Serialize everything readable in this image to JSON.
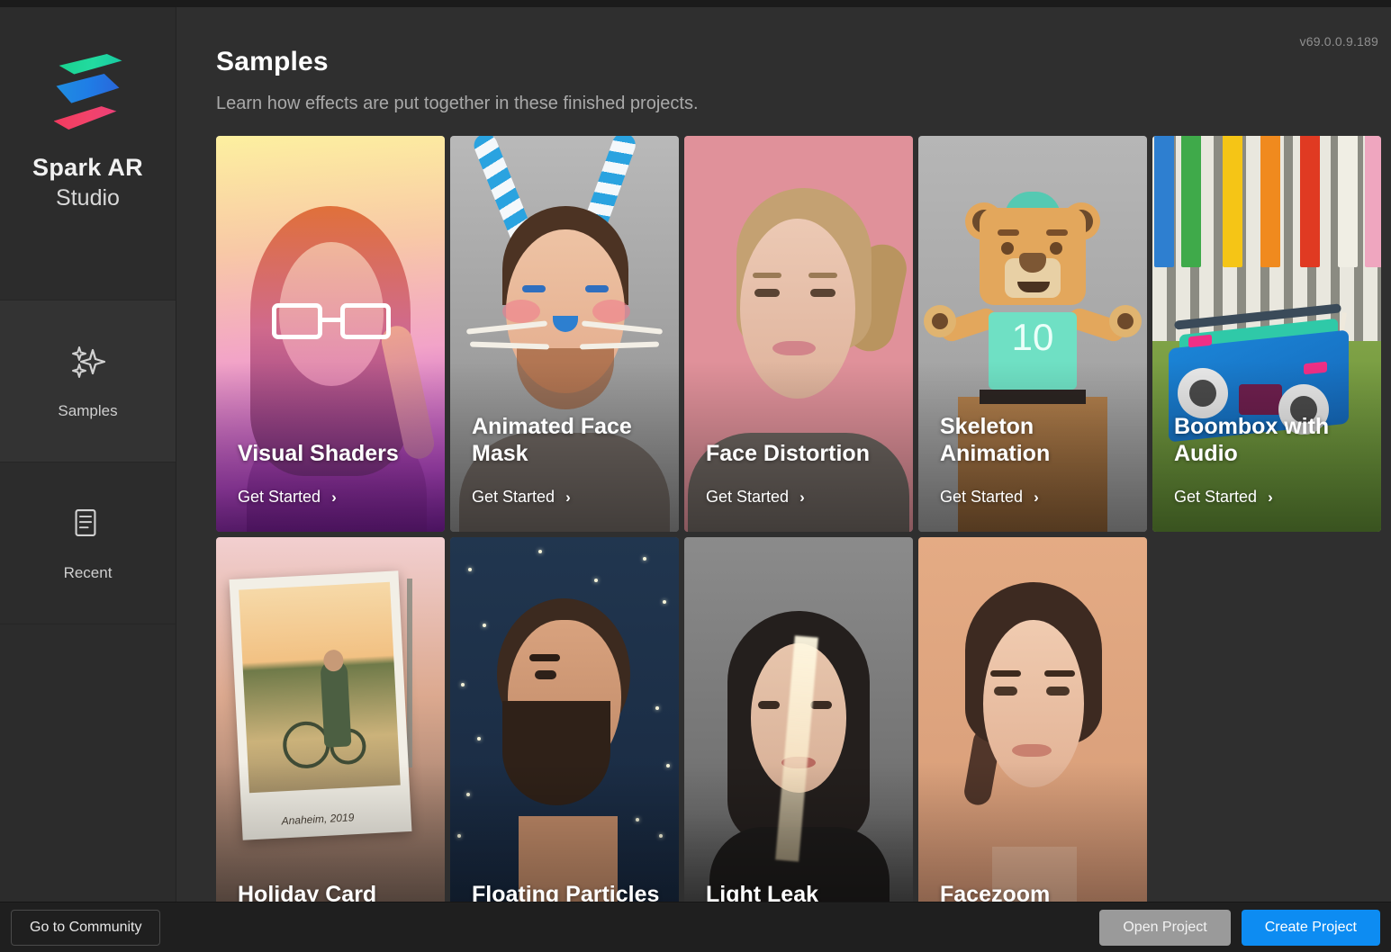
{
  "app": {
    "name": "Spark AR",
    "name_sub": "Studio",
    "version": "v69.0.0.9.189"
  },
  "sidebar": {
    "logo_icon": "spark-ar-logo",
    "items": [
      {
        "label": "Samples",
        "icon": "sparkles-icon",
        "active": true
      },
      {
        "label": "Recent",
        "icon": "document-list-icon",
        "active": false
      }
    ]
  },
  "main": {
    "title": "Samples",
    "subtitle": "Learn how effects are put together in these finished projects.",
    "cta_label": "Get Started",
    "cta_chevron": "›",
    "cards": [
      {
        "title": "Visual Shaders",
        "cta": "Get Started"
      },
      {
        "title": "Animated Face Mask",
        "cta": "Get Started"
      },
      {
        "title": "Face Distortion",
        "cta": "Get Started"
      },
      {
        "title": "Skeleton Animation",
        "cta": "Get Started",
        "jersey_number": "10"
      },
      {
        "title": "Boombox with Audio",
        "cta": "Get Started"
      },
      {
        "title": "Holiday Card",
        "cta": "",
        "photo_caption": "Anaheim, 2019"
      },
      {
        "title": "Floating Particles",
        "cta": ""
      },
      {
        "title": "Light Leak",
        "cta": ""
      },
      {
        "title": "Facezoom",
        "cta": ""
      }
    ]
  },
  "bottombar": {
    "community_label": "Go to Community",
    "open_label": "Open Project",
    "create_label": "Create Project"
  },
  "colors": {
    "accent_blue": "#0d8cf2",
    "grey_button": "#9a9a9a",
    "app_bg": "#2f2f2f",
    "sidebar_bg": "#2c2c2c",
    "bottom_bg": "#1f1f1f"
  }
}
